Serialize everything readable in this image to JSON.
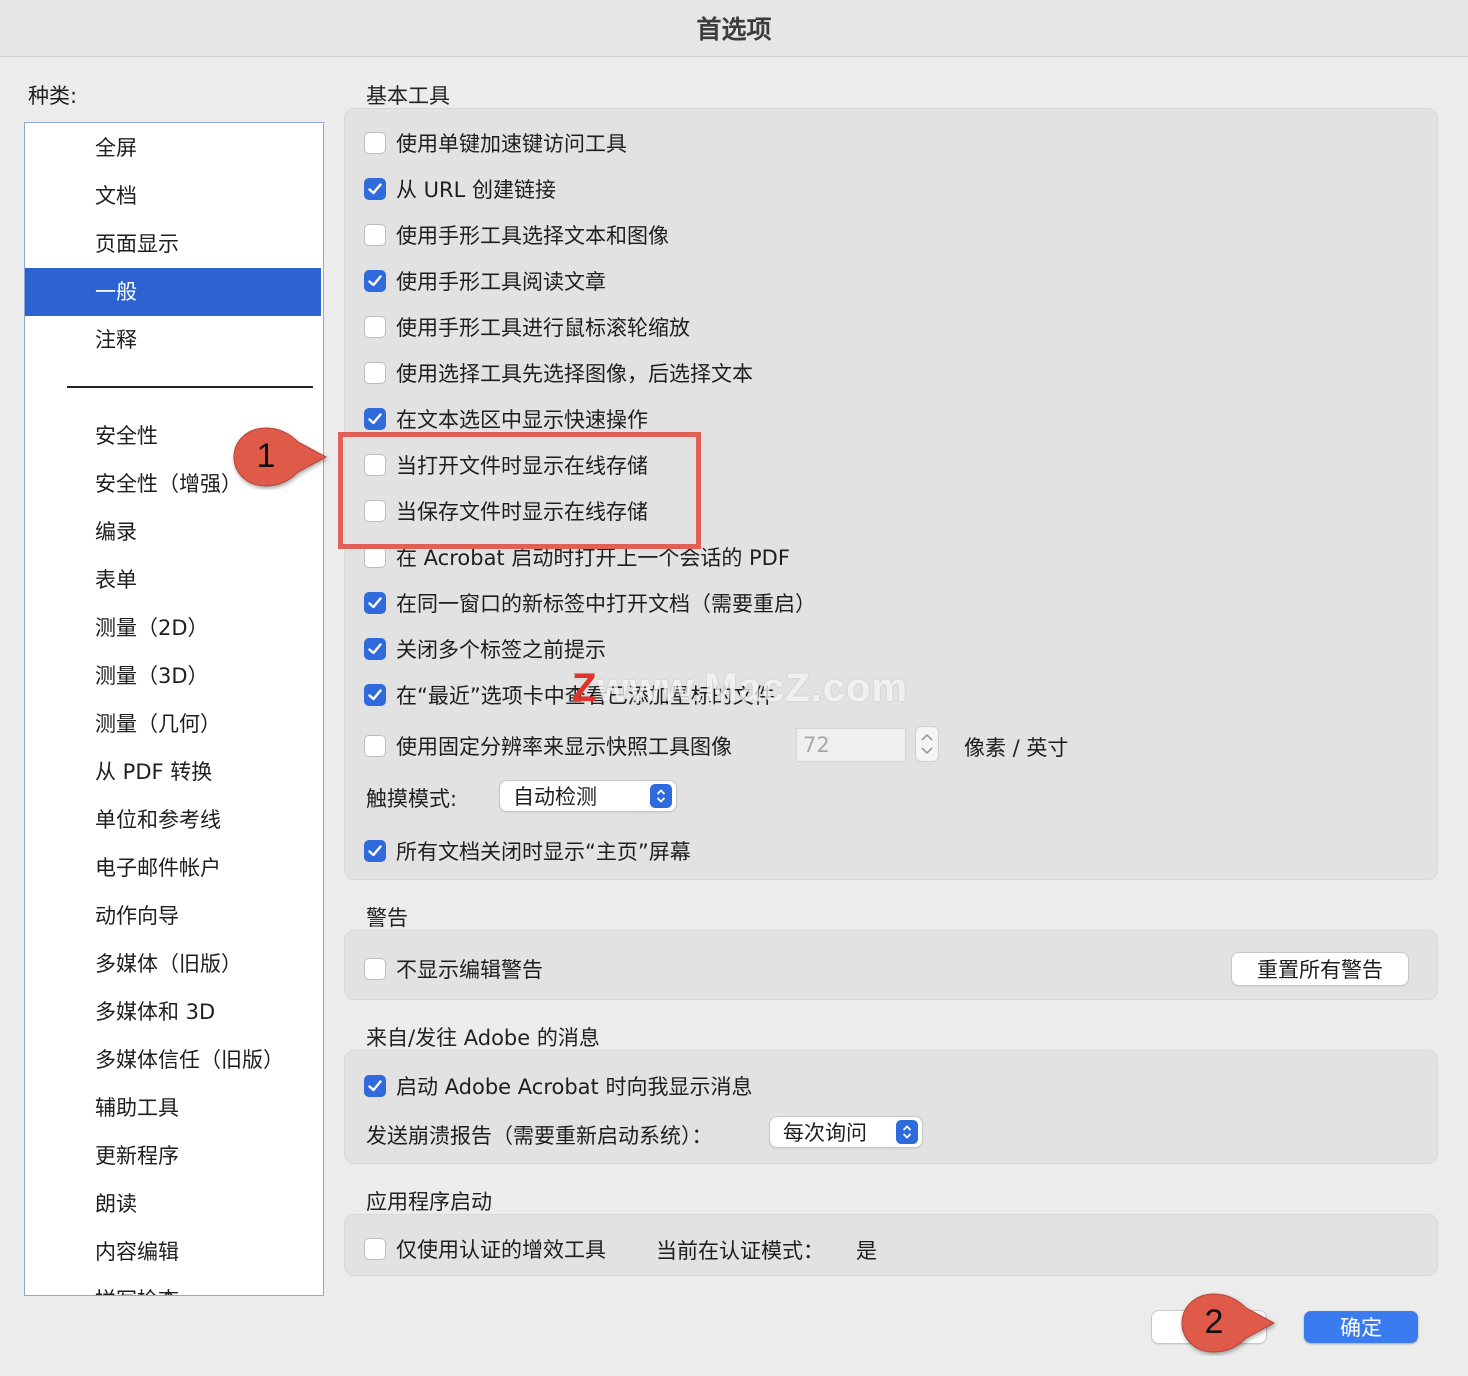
{
  "window": {
    "title": "首选项"
  },
  "sidebar": {
    "heading": "种类:",
    "items": [
      {
        "label": "全屏",
        "selected": false
      },
      {
        "label": "文档",
        "selected": false
      },
      {
        "label": "页面显示",
        "selected": false
      },
      {
        "label": "一般",
        "selected": true
      },
      {
        "label": "注释",
        "selected": false
      },
      {
        "label": "安全性",
        "selected": false
      },
      {
        "label": "安全性（增强）",
        "selected": false
      },
      {
        "label": "编录",
        "selected": false
      },
      {
        "label": "表单",
        "selected": false
      },
      {
        "label": "测量（2D）",
        "selected": false
      },
      {
        "label": "测量（3D）",
        "selected": false
      },
      {
        "label": "测量（几何）",
        "selected": false
      },
      {
        "label": "从 PDF 转换",
        "selected": false
      },
      {
        "label": "单位和参考线",
        "selected": false
      },
      {
        "label": "电子邮件帐户",
        "selected": false
      },
      {
        "label": "动作向导",
        "selected": false
      },
      {
        "label": "多媒体（旧版）",
        "selected": false
      },
      {
        "label": "多媒体和 3D",
        "selected": false
      },
      {
        "label": "多媒体信任（旧版）",
        "selected": false
      },
      {
        "label": "辅助工具",
        "selected": false
      },
      {
        "label": "更新程序",
        "selected": false
      },
      {
        "label": "朗读",
        "selected": false
      },
      {
        "label": "内容编辑",
        "selected": false
      },
      {
        "label": "拼写检查",
        "selected": false
      }
    ]
  },
  "basic_tools": {
    "heading": "基本工具",
    "options": [
      {
        "label": "使用单键加速键访问工具",
        "checked": false
      },
      {
        "label": "从 URL 创建链接",
        "checked": true
      },
      {
        "label": "使用手形工具选择文本和图像",
        "checked": false
      },
      {
        "label": "使用手形工具阅读文章",
        "checked": true
      },
      {
        "label": "使用手形工具进行鼠标滚轮缩放",
        "checked": false
      },
      {
        "label": "使用选择工具先选择图像，后选择文本",
        "checked": false
      },
      {
        "label": "在文本选区中显示快速操作",
        "checked": true
      },
      {
        "label": "当打开文件时显示在线存储",
        "checked": false
      },
      {
        "label": "当保存文件时显示在线存储",
        "checked": false
      },
      {
        "label": "在 Acrobat 启动时打开上一个会话的 PDF",
        "checked": false
      },
      {
        "label": "在同一窗口的新标签中打开文档（需要重启）",
        "checked": true
      },
      {
        "label": "关闭多个标签之前提示",
        "checked": true
      },
      {
        "label": "在“最近”选项卡中查看已添加星标的文件",
        "checked": true
      }
    ],
    "fixed_resolution": {
      "label": "使用固定分辨率来显示快照工具图像",
      "checked": false,
      "value": "72",
      "unit": "像素 / 英寸"
    },
    "touch_mode": {
      "label": "触摸模式:",
      "value": "自动检测"
    },
    "show_home": {
      "label": "所有文档关闭时显示“主页”屏幕",
      "checked": true
    }
  },
  "warnings": {
    "heading": "警告",
    "option": {
      "label": "不显示编辑警告",
      "checked": false
    },
    "reset_button": "重置所有警告"
  },
  "messages": {
    "heading": "来自/发往 Adobe 的消息",
    "option": {
      "label": "启动 Adobe Acrobat 时向我显示消息",
      "checked": true
    },
    "crash_label": "发送崩溃报告（需要重新启动系统）：",
    "crash_value": "每次询问"
  },
  "app_startup": {
    "heading": "应用程序启动",
    "option": {
      "label": "仅使用认证的增效工具",
      "checked": false
    },
    "cert_mode_label": "当前在认证模式：",
    "cert_mode_value": "是"
  },
  "footer": {
    "cancel_label": "",
    "ok_label": "确定"
  },
  "annotations": {
    "callout_1": "1",
    "callout_2": "2",
    "watermark": "www.MacZ.com",
    "watermark_logo": "Z",
    "highlight_color": "#e06055",
    "callout_color": "#e05a4a"
  },
  "colors": {
    "accent": "#2f6bdc",
    "selection": "#2d62d3",
    "primary_button": "#3a7cf0"
  }
}
